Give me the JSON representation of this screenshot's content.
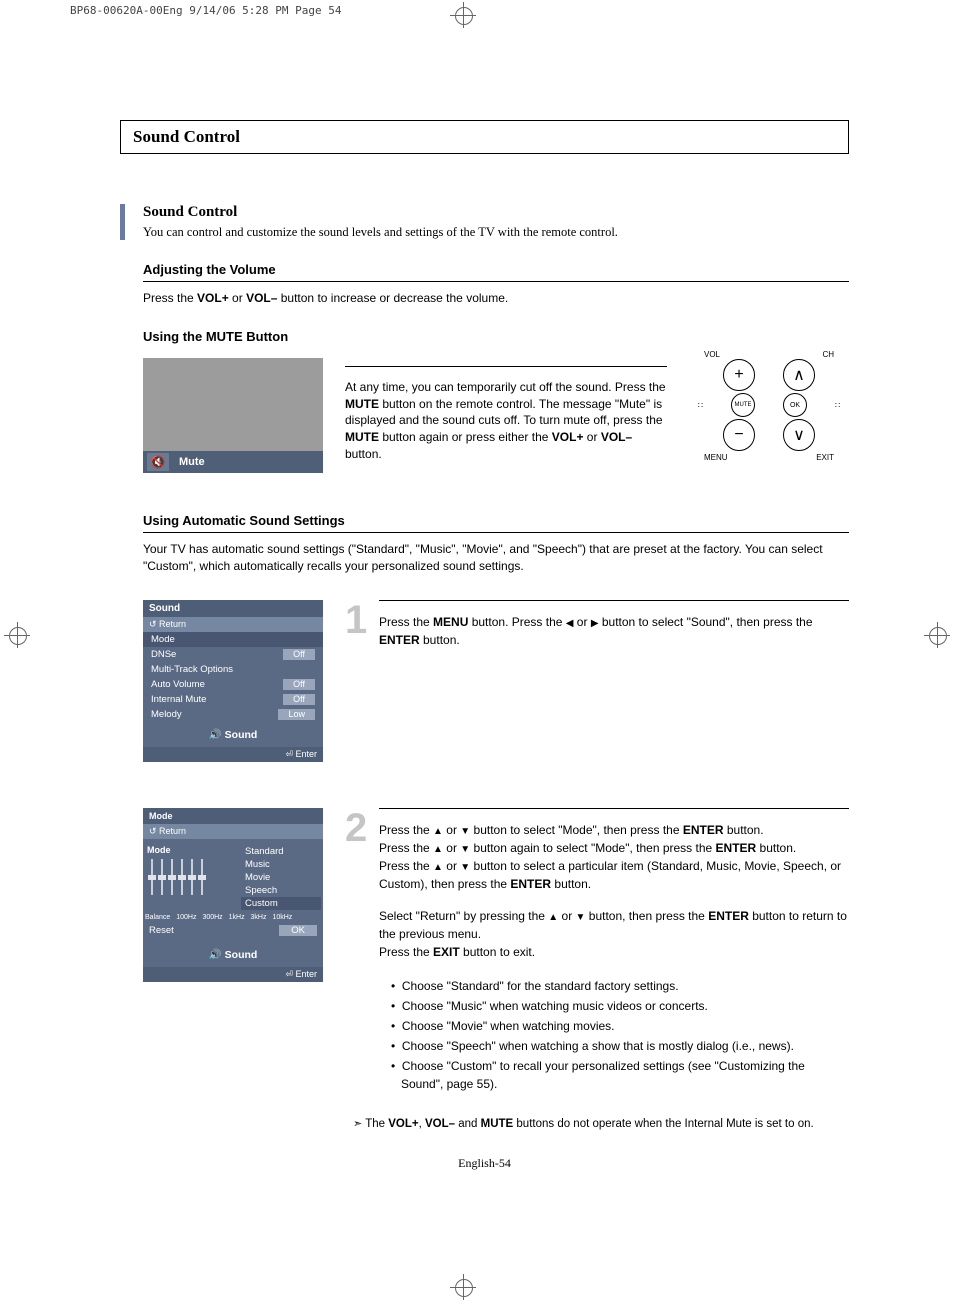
{
  "cropLine": "BP68-00620A-00Eng  9/14/06  5:28 PM  Page 54",
  "pageTitle": "Sound Control",
  "sectionTitle": "Sound Control",
  "sectionIntro": "You can control and customize the sound levels and settings of the TV with the remote control.",
  "adjVolHeading": "Adjusting the Volume",
  "adjVol_a": "Press the ",
  "adjVol_b": "VOL+",
  "adjVol_c": " or ",
  "adjVol_d": "VOL–",
  "adjVol_e": " button to increase or decrease the volume.",
  "muteHeading": "Using the MUTE Button",
  "muteLabel": "Mute",
  "muteIconGlyph": "🔇",
  "mutePara_a": "At any time, you can temporarily cut off the sound. Press the ",
  "mutePara_b": "MUTE",
  "mutePara_c": " button on the remote control. The message \"Mute\" is displayed and the sound cuts off. To turn mute off, press the ",
  "mutePara_d": "MUTE",
  "mutePara_e": " button again or press either the ",
  "mutePara_f": "VOL+",
  "mutePara_g": " or ",
  "mutePara_h": "VOL–",
  "mutePara_i": " button.",
  "autoHeading": "Using Automatic Sound Settings",
  "autoIntro": "Your TV has automatic sound settings (\"Standard\", \"Music\", \"Movie\", and \"Speech\") that are preset at the factory. You can select \"Custom\", which automatically recalls your personalized sound settings.",
  "menu1": {
    "title": "Sound",
    "return": "↺ Return",
    "rows": [
      "Mode",
      "DNSe",
      "Multi-Track Options",
      "Auto Volume",
      "Internal Mute",
      "Melody"
    ],
    "vals": [
      "",
      "Off",
      "",
      "Off",
      "Off",
      "Low"
    ],
    "soundLabel": "Sound",
    "enter": "⏎ Enter"
  },
  "step1": {
    "num": "1",
    "a": "Press the ",
    "b": "MENU",
    "c": " button. Press the ",
    "d": " or ",
    "e": " button to select \"Sound\", then press the ",
    "f": "ENTER",
    "g": " button."
  },
  "menu2": {
    "title": "Mode",
    "return": "↺ Return",
    "modeLabel": "Mode",
    "opts": [
      "Standard",
      "Music",
      "Movie",
      "Speech",
      "Custom"
    ],
    "eqLabels": [
      "Balance",
      "100Hz",
      "300Hz",
      "1kHz",
      "3kHz",
      "10kHz"
    ],
    "reset": "Reset",
    "ok": "OK",
    "soundLabel": "Sound",
    "enter": "⏎ Enter"
  },
  "step2": {
    "num": "2",
    "a": "Press the ",
    "b": " or ",
    "c": " button to select \"Mode\", then press the ",
    "d": "ENTER",
    "e": " button.",
    "f": "Press the ",
    "g": " or ",
    "h": " button again to select \"Mode\", then press the ",
    "i": "ENTER",
    "j": " button.",
    "k": "Press the ",
    "l": " or ",
    "m": " button to select a particular item (Standard, Music, Movie, Speech, or Custom), then press the ",
    "n": "ENTER",
    "o": " button.",
    "ret_a": "Select \"Return\" by pressing the ",
    "ret_b": " or ",
    "ret_c": " button, then press the ",
    "ret_d": "ENTER",
    "ret_e": " button to return to the previous menu.",
    "exit_a": "Press the ",
    "exit_b": "EXIT",
    "exit_c": " button to exit."
  },
  "bullets": [
    "Choose \"Standard\" for the standard factory settings.",
    "Choose \"Music\" when watching music videos or concerts.",
    "Choose \"Movie\" when watching movies.",
    "Choose \"Speech\" when watching a show that is mostly dialog (i.e., news).",
    "Choose \"Custom\" to recall your personalized settings (see \"Customizing the Sound\", page 55)."
  ],
  "note_a": "The ",
  "note_b": "VOL+",
  "note_c": ", ",
  "note_d": "VOL–",
  "note_e": " and ",
  "note_f": "MUTE",
  "note_g": " buttons do not operate when the Internal Mute is set to on.",
  "footer": "English-54",
  "remote": {
    "vol": "VOL",
    "ch": "CH",
    "mute": "MUTE",
    "menu": "MENU",
    "exit": "EXIT",
    "ok": "OK"
  },
  "glyph": {
    "up": "▲",
    "down": "▼",
    "left": "◀",
    "right": "▶",
    "plus": "+",
    "minus": "−",
    "chUp": "∧",
    "chDown": "∨",
    "noteIcon": "➣",
    "speaker": "🔊"
  }
}
